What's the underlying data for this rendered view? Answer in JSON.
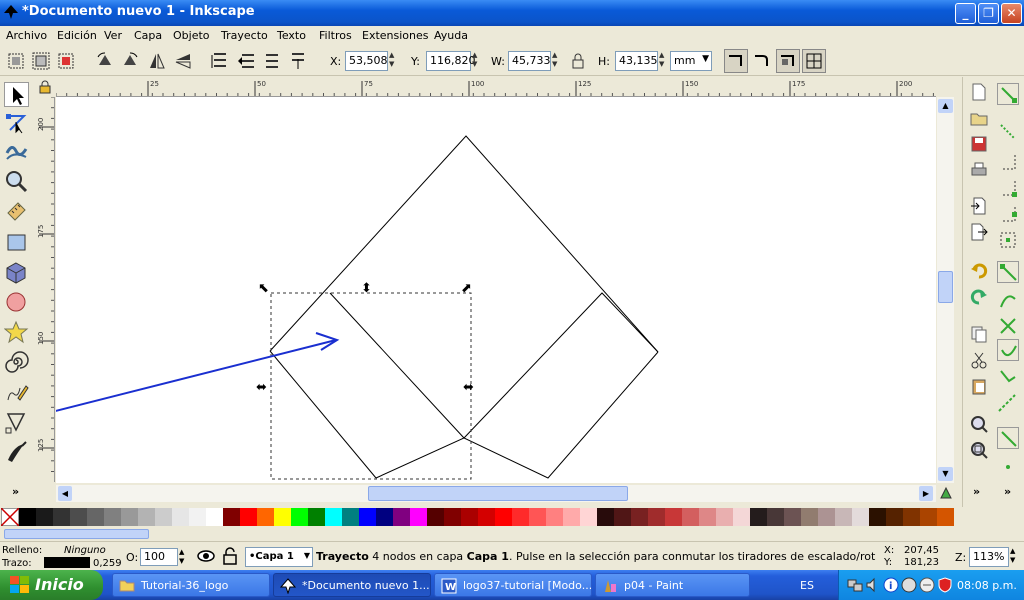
{
  "window": {
    "title": "*Documento nuevo 1 - Inkscape"
  },
  "menu": [
    "Archivo",
    "Edición",
    "Ver",
    "Capa",
    "Objeto",
    "Trayecto",
    "Texto",
    "Filtros",
    "Extensiones",
    "Ayuda"
  ],
  "toolbar": {
    "x_label": "X:",
    "x_value": "53,508",
    "y_label": "Y:",
    "y_value": "116,820",
    "w_label": "W:",
    "w_value": "45,733",
    "h_label": "H:",
    "h_value": "43,135",
    "unit": "mm"
  },
  "ruler": {
    "h_ticks": [
      "25",
      "50",
      "75",
      "100",
      "125",
      "150",
      "175",
      "200"
    ],
    "v_ticks": [
      "200",
      "175",
      "150",
      "125"
    ]
  },
  "status": {
    "fill_label": "Relleno:",
    "fill_value": "Ninguno",
    "stroke_label": "Trazo:",
    "stroke_width": "0,259",
    "opacity_label": "O:",
    "opacity_value": "100",
    "layer": "•Capa 1",
    "message_bold": "Trayecto",
    "message_mid": " 4 nodos en capa ",
    "message_layer": "Capa 1",
    "message_rest": ". Pulse en la selección para conmutar los tiradores de escalado/rotación.",
    "cursor_x_label": "X:",
    "cursor_x": "207,45",
    "cursor_y_label": "Y:",
    "cursor_y": "181,23",
    "zoom_label": "Z:",
    "zoom_value": "113%"
  },
  "palette": [
    "#000000",
    "#1a1a1a",
    "#333333",
    "#4d4d4d",
    "#666666",
    "#808080",
    "#999999",
    "#b3b3b3",
    "#cccccc",
    "#e6e6e6",
    "#f2f2f2",
    "#ffffff",
    "#800000",
    "#ff0000",
    "#ff6600",
    "#ffff00",
    "#00ff00",
    "#008000",
    "#00ffff",
    "#008080",
    "#0000ff",
    "#000080",
    "#800080",
    "#ff00ff",
    "#550000",
    "#800000",
    "#aa0000",
    "#d40000",
    "#ff0000",
    "#ff2a2a",
    "#ff5555",
    "#ff8080",
    "#ffaaaa",
    "#ffd5d5",
    "#280b0b",
    "#501616",
    "#782121",
    "#a02c2c",
    "#c83737",
    "#d35f5f",
    "#de8787",
    "#e9afaf",
    "#f4d7d7",
    "#241c1c",
    "#483737",
    "#6c5353",
    "#917c6f",
    "#ac9393",
    "#c8b7b7",
    "#e3dbdb",
    "#2b1100",
    "#552200",
    "#803300",
    "#aa4400",
    "#d45500"
  ],
  "taskbar": {
    "start": "Inicio",
    "tasks": [
      "Tutorial-36_logo",
      "*Documento nuevo 1...",
      "logo37-tutorial [Modo...",
      "p04 - Paint"
    ],
    "lang": "ES",
    "clock": "08:08 p.m."
  }
}
